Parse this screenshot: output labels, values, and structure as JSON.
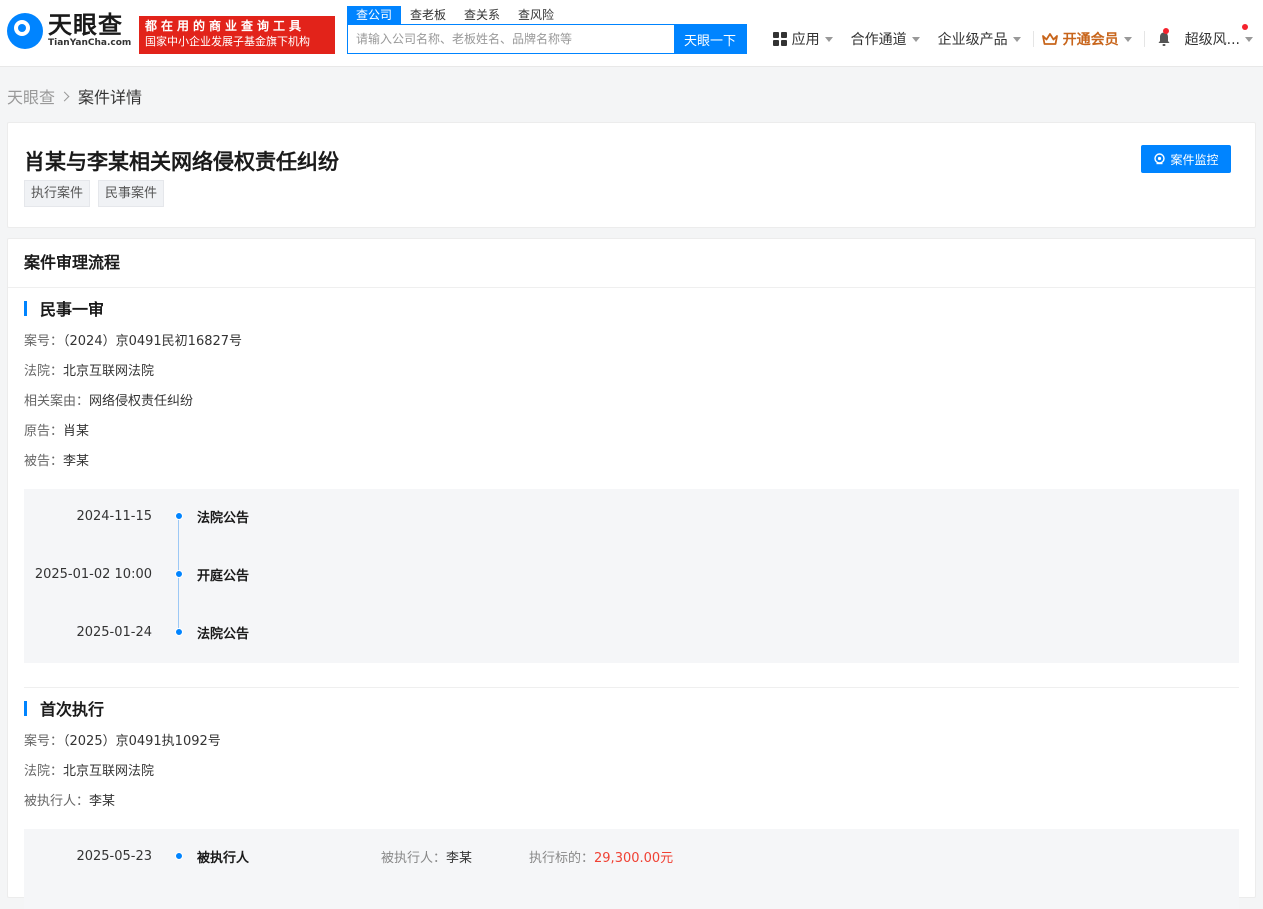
{
  "header": {
    "logo_cn": "天眼查",
    "logo_en": "TianYanCha.com",
    "slogan_line1": "都在用的商业查询工具",
    "slogan_line2": "国家中小企业发展子基金旗下机构",
    "search_tabs": [
      "查公司",
      "查老板",
      "查关系",
      "查风险"
    ],
    "search_placeholder": "请输入公司名称、老板姓名、品牌名称等",
    "search_button": "天眼一下",
    "nav": {
      "apps": "应用",
      "partner": "合作通道",
      "enterprise": "企业级产品",
      "vip": "开通会员",
      "user": "超级风..."
    }
  },
  "breadcrumb": {
    "home": "天眼查",
    "current": "案件详情"
  },
  "case": {
    "title": "肖某与李某相关网络侵权责任纠纷",
    "tags": [
      "执行案件",
      "民事案件"
    ],
    "monitor_button": "案件监控"
  },
  "process": {
    "heading": "案件审理流程",
    "first_trial": {
      "title": "民事一审",
      "fields": [
        {
          "key": "案号：",
          "value": "（2024）京0491民初16827号"
        },
        {
          "key": "法院：",
          "value": "北京互联网法院"
        },
        {
          "key": "相关案由：",
          "value": "网络侵权责任纠纷"
        },
        {
          "key": "原告：",
          "value": "肖某"
        },
        {
          "key": "被告：",
          "value": "李某"
        }
      ],
      "timeline": [
        {
          "date": "2024-11-15",
          "event": "法院公告"
        },
        {
          "date": "2025-01-02 10:00",
          "event": "开庭公告"
        },
        {
          "date": "2025-01-24",
          "event": "法院公告"
        }
      ]
    },
    "execution": {
      "title": "首次执行",
      "fields": [
        {
          "key": "案号：",
          "value": "（2025）京0491执1092号"
        },
        {
          "key": "法院：",
          "value": "北京互联网法院"
        },
        {
          "key": "被执行人：",
          "value": "李某"
        }
      ],
      "timeline": [
        {
          "date": "2025-05-23",
          "event": "被执行人",
          "person_label": "被执行人：",
          "person": "李某",
          "amount_label": "执行标的：",
          "amount": "29,300.00元"
        }
      ]
    }
  },
  "colors": {
    "brand": "#0084ff",
    "slogan_red": "#e2231a",
    "vip": "#c8651b",
    "amount": "#f04134"
  },
  "icons": [
    "apps-grid-icon",
    "crown-icon",
    "bell-icon",
    "monitor-location-icon",
    "chevron-right-icon"
  ]
}
